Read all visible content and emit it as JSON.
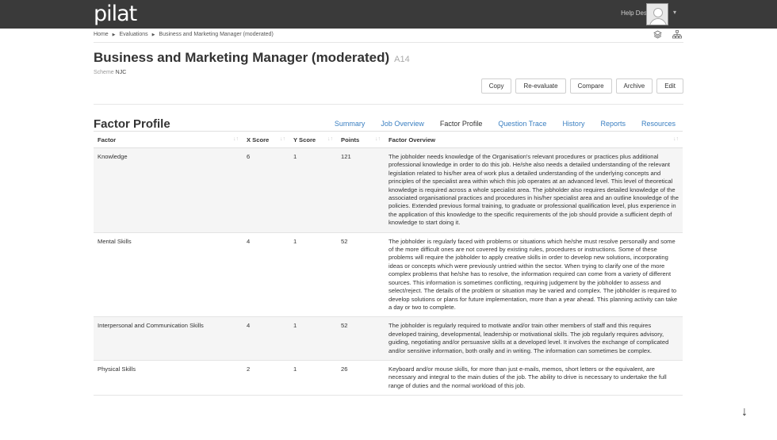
{
  "app": {
    "logo": "pilat",
    "help_desk": "Help Desk",
    "user_menu_caret": "▾"
  },
  "breadcrumb": [
    "Home",
    "Evaluations",
    "Business and Marketing Manager (moderated)"
  ],
  "breadcrumb_sep": "▶",
  "header": {
    "title": "Business and Marketing Manager (moderated)",
    "code": "A14",
    "scheme_label": "Scheme",
    "scheme_value": "NJC"
  },
  "actions": [
    "Copy",
    "Re-evaluate",
    "Compare",
    "Archive",
    "Edit"
  ],
  "section_title": "Factor Profile",
  "tabs": [
    "Summary",
    "Job Overview",
    "Factor Profile",
    "Question Trace",
    "History",
    "Reports",
    "Resources"
  ],
  "active_tab": "Factor Profile",
  "table": {
    "columns": [
      "Factor",
      "X Score",
      "Y Score",
      "Points",
      "Factor Overview"
    ],
    "rows": [
      {
        "factor": "Knowledge",
        "x": "6",
        "y": "1",
        "points": "121",
        "overview": "The jobholder needs knowledge of the Organisation's relevant procedures or practices plus additional professional knowledge in order to do this job. He/she also needs a detailed understanding of the relevant legislation related to his/her area of work plus a detailed understanding of the underlying concepts and principles of the specialist area within which this job operates at an advanced level. This level of theoretical knowledge is required across a whole specialist area. The jobholder also requires detailed knowledge of the associated organisational practices and procedures in his/her specialist area and an outline knowledge of the policies. Extended previous formal training, to graduate or professional qualification level, plus experience in the application of this knowledge to the specific requirements of the job should provide a sufficient depth of knowledge to start doing it."
      },
      {
        "factor": "Mental Skills",
        "x": "4",
        "y": "1",
        "points": "52",
        "overview": "The jobholder is regularly faced with problems or situations which he/she must resolve personally and some of the more difficult ones are not covered by existing rules, procedures or instructions. Some of these problems will require the jobholder to apply creative skills in order to develop new solutions, incorporating ideas or concepts which were previously untried within the sector. When trying to clarify one of the more complex problems that he/she has to resolve, the information required can come from a variety of different sources. This information is sometimes conflicting, requiring judgement by the jobholder to assess and select/reject. The details of the problem or situation may be varied and complex. The jobholder is required to develop solutions or plans for future implementation, more than a year ahead. This planning activity can take a day or two to complete."
      },
      {
        "factor": "Interpersonal and Communication Skills",
        "x": "4",
        "y": "1",
        "points": "52",
        "overview": "The jobholder is regularly required to motivate and/or train other members of staff and this requires developed training, developmental, leadership or motivational skills. The job regularly requires advisory, guiding, negotiating and/or persuasive skills at a developed level. It involves the exchange of complicated and/or sensitive information, both orally and in writing. The information can sometimes be complex."
      },
      {
        "factor": "Physical Skills",
        "x": "2",
        "y": "1",
        "points": "26",
        "overview": "Keyboard and/or mouse skills, for more than just e-mails, memos, short letters or the equivalent, are necessary and integral to the main duties of the job. The ability to drive is necessary to undertake the full range of duties and the normal workload of this job."
      }
    ]
  },
  "scroll_down_glyph": "↓"
}
